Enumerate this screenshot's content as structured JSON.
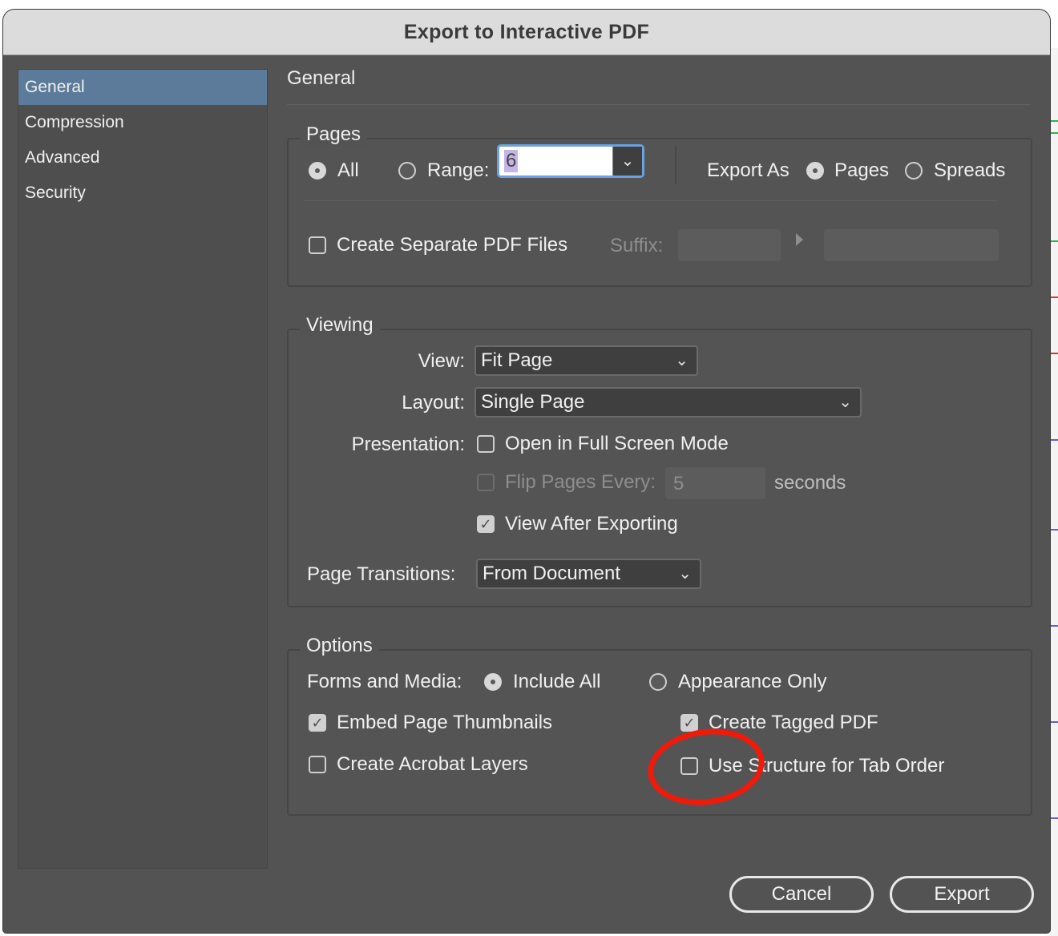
{
  "window": {
    "title": "Export to Interactive PDF"
  },
  "sidebar": {
    "items": [
      {
        "label": "General",
        "selected": true
      },
      {
        "label": "Compression",
        "selected": false
      },
      {
        "label": "Advanced",
        "selected": false
      },
      {
        "label": "Security",
        "selected": false
      }
    ]
  },
  "main": {
    "section_title": "General"
  },
  "pages": {
    "group_label": "Pages",
    "all_label": "All",
    "all_selected": true,
    "range_label": "Range:",
    "range_value": "6",
    "export_as_label": "Export As",
    "pages_option": "Pages",
    "pages_selected": true,
    "spreads_option": "Spreads",
    "separate_files_label": "Create Separate PDF Files",
    "separate_files_checked": false,
    "suffix_label": "Suffix:"
  },
  "viewing": {
    "group_label": "Viewing",
    "view_label": "View:",
    "view_value": "Fit Page",
    "layout_label": "Layout:",
    "layout_value": "Single Page",
    "presentation_label": "Presentation:",
    "full_screen_label": "Open in Full Screen Mode",
    "full_screen_checked": false,
    "flip_pages_label": "Flip Pages Every:",
    "flip_pages_value": "5",
    "seconds_label": "seconds",
    "view_after_label": "View After Exporting",
    "view_after_checked": true,
    "transitions_label": "Page Transitions:",
    "transitions_value": "From Document"
  },
  "options": {
    "group_label": "Options",
    "forms_label": "Forms and Media:",
    "include_all_label": "Include All",
    "include_all_selected": true,
    "appearance_only_label": "Appearance Only",
    "embed_thumbnails_label": "Embed Page Thumbnails",
    "embed_thumbnails_checked": true,
    "tagged_pdf_label": "Create Tagged PDF",
    "tagged_pdf_checked": true,
    "acrobat_layers_label": "Create Acrobat Layers",
    "acrobat_layers_checked": false,
    "tab_order_label": "Use Structure for Tab Order",
    "tab_order_checked": false
  },
  "buttons": {
    "cancel": "Cancel",
    "export": "Export"
  },
  "icons": {
    "checkmark": "check-icon",
    "dropdown": "chevron-down-icon",
    "suffix_arrow": "triangle-right-icon"
  },
  "colors": {
    "dialog_bg": "#535353",
    "selected_sidebar": "#5c7b9a",
    "focus_ring": "#6aa1de",
    "annotation": "#f01a0a"
  }
}
